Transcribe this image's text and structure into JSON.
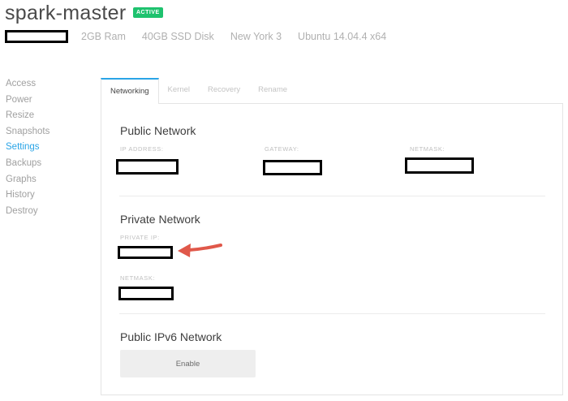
{
  "droplet": {
    "name": "spark-master",
    "status": "ACTIVE",
    "specs": [
      "2GB Ram",
      "40GB SSD Disk",
      "New York 3",
      "Ubuntu 14.04.4 x64"
    ]
  },
  "sidebar": {
    "items": [
      {
        "label": "Access"
      },
      {
        "label": "Power"
      },
      {
        "label": "Resize"
      },
      {
        "label": "Snapshots"
      },
      {
        "label": "Settings"
      },
      {
        "label": "Backups"
      },
      {
        "label": "Graphs"
      },
      {
        "label": "History"
      },
      {
        "label": "Destroy"
      }
    ],
    "active": "Settings"
  },
  "tabs": [
    {
      "label": "Networking"
    },
    {
      "label": "Kernel"
    },
    {
      "label": "Recovery"
    },
    {
      "label": "Rename"
    }
  ],
  "public_network": {
    "title": "Public Network",
    "ip_label": "IP ADDRESS:",
    "gateway_label": "GATEWAY:",
    "netmask_label": "NETMASK:"
  },
  "private_network": {
    "title": "Private Network",
    "ip_label": "PRIVATE IP:",
    "netmask_label": "NETMASK:"
  },
  "ipv6": {
    "title": "Public IPv6 Network",
    "enable_label": "Enable"
  },
  "colors": {
    "accent": "#2aa4e6",
    "status": "#1ec26e",
    "arrow": "#e0584a"
  }
}
